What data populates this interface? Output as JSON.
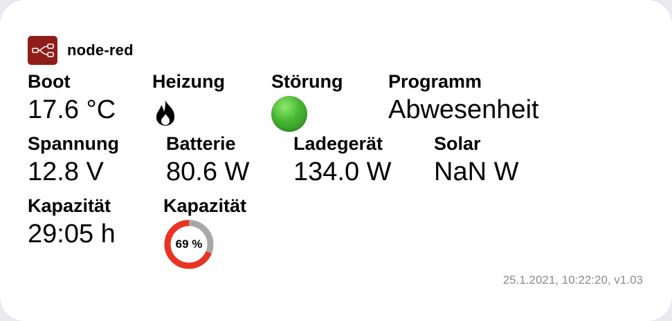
{
  "app": {
    "name": "node-red"
  },
  "row1": {
    "boot": {
      "label": "Boot",
      "value": "17.6 °C"
    },
    "heizung": {
      "label": "Heizung",
      "icon": "flame-icon"
    },
    "stoerung": {
      "label": "Störung",
      "icon": "green-status-icon",
      "color": "#45b531"
    },
    "programm": {
      "label": "Programm",
      "value": "Abwesenheit"
    }
  },
  "row2": {
    "spannung": {
      "label": "Spannung",
      "value": "12.8 V"
    },
    "batterie": {
      "label": "Batterie",
      "value": "80.6 W"
    },
    "ladegeraet": {
      "label": "Ladegerät",
      "value": "134.0 W"
    },
    "solar": {
      "label": "Solar",
      "value": "NaN W"
    }
  },
  "row3": {
    "kapazitaet_time": {
      "label": "Kapazität",
      "value": "29:05 h"
    },
    "kapazitaet_gauge": {
      "label": "Kapazität",
      "text": "69 %",
      "percent": 69,
      "fill_color": "#ea3323",
      "track_color": "#a8a8a8"
    }
  },
  "footer": {
    "text": "25.1.2021, 10:22:20, v1.03"
  }
}
